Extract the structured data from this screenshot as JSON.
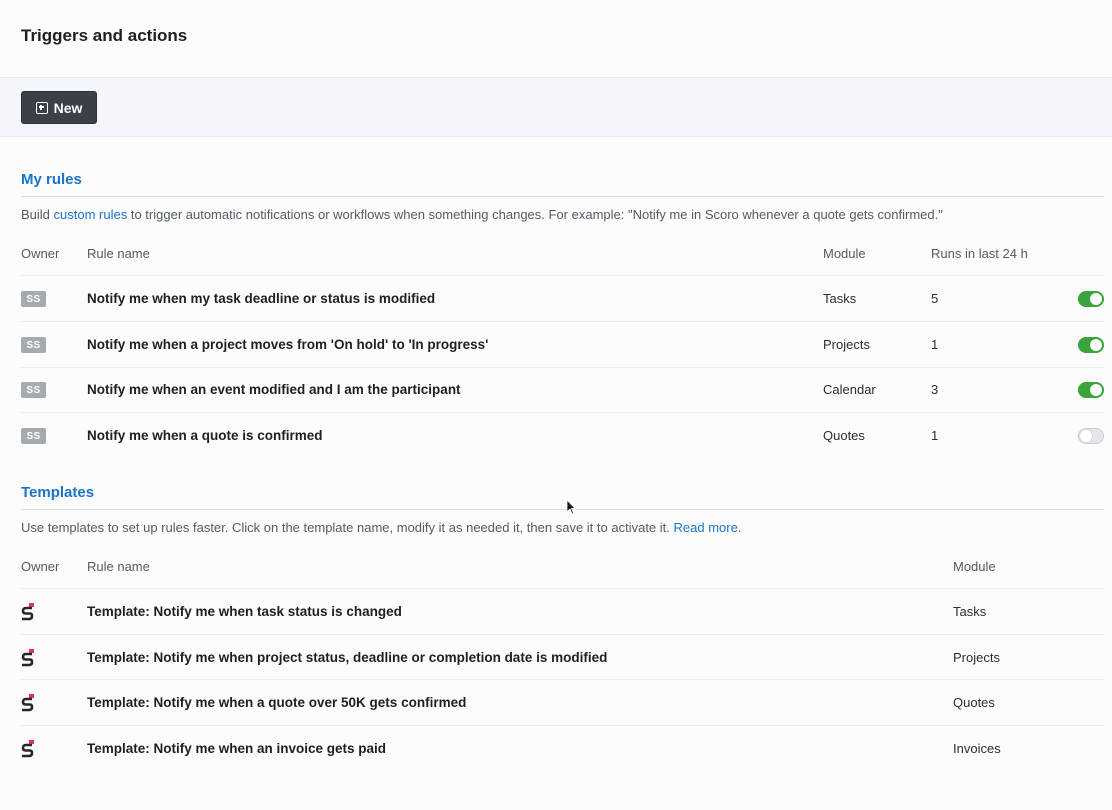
{
  "header": {
    "title": "Triggers and actions"
  },
  "toolbar": {
    "new_label": "New"
  },
  "my_rules": {
    "title": "My rules",
    "desc_prefix": "Build ",
    "desc_link": "custom rules",
    "desc_suffix": " to trigger automatic notifications or workflows when something changes. For example: \"Notify me in Scoro whenever a quote gets confirmed.\"",
    "columns": {
      "owner": "Owner",
      "rule_name": "Rule name",
      "module": "Module",
      "runs": "Runs in last 24 h"
    },
    "rows": [
      {
        "owner": "SS",
        "name": "Notify me when my task deadline or status is modified",
        "module": "Tasks",
        "runs": "5",
        "enabled": true
      },
      {
        "owner": "SS",
        "name": "Notify me when a project moves from 'On hold' to 'In progress'",
        "module": "Projects",
        "runs": "1",
        "enabled": true
      },
      {
        "owner": "SS",
        "name": "Notify me when an event modified and I am the participant",
        "module": "Calendar",
        "runs": "3",
        "enabled": true
      },
      {
        "owner": "SS",
        "name": "Notify me when a quote is confirmed",
        "module": "Quotes",
        "runs": "1",
        "enabled": false
      }
    ]
  },
  "templates": {
    "title": "Templates",
    "desc_prefix": "Use templates to set up rules faster. Click on the template name, modify it as needed it, then save it to activate it. ",
    "desc_link": "Read more.",
    "columns": {
      "owner": "Owner",
      "rule_name": "Rule name",
      "module": "Module"
    },
    "rows": [
      {
        "name": "Template: Notify me when task status is changed",
        "module": "Tasks"
      },
      {
        "name": "Template: Notify me when project status, deadline or completion date is modified",
        "module": "Projects"
      },
      {
        "name": "Template: Notify me when a quote over 50K gets confirmed",
        "module": "Quotes"
      },
      {
        "name": "Template: Notify me when an invoice gets paid",
        "module": "Invoices"
      }
    ]
  },
  "colors": {
    "accent": "#1a75c7",
    "toggle_on": "#3aa33a",
    "button_dark": "#3c4148",
    "logo_red": "#e2344b"
  }
}
